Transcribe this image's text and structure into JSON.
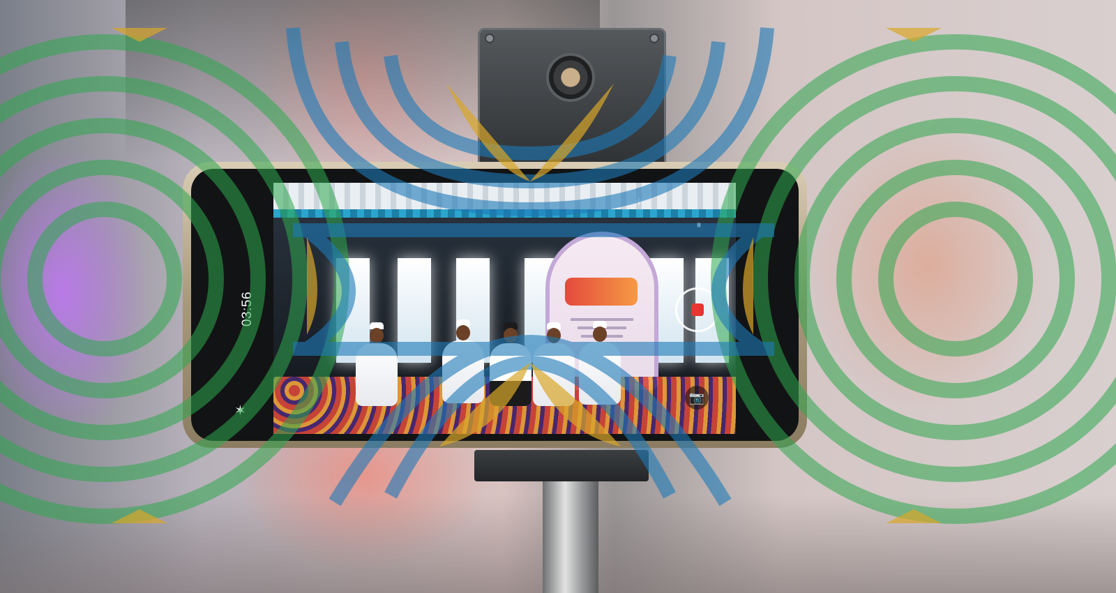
{
  "camera_ui": {
    "timer": "03:56",
    "pause_glyph": "⏸",
    "plus_glyph": "+",
    "camera_glyph": "📷",
    "flash_glyph": "✶"
  },
  "icons": {
    "record": "record-icon",
    "pause": "pause-icon",
    "zoom": "plus-icon",
    "snapshot": "camera-icon",
    "flash": "flash-icon"
  },
  "colors": {
    "overlay_green": "#2fa84f",
    "overlay_blue": "#1e7ab8",
    "overlay_gold": "#d8a72a",
    "record_red": "#e8352f"
  }
}
